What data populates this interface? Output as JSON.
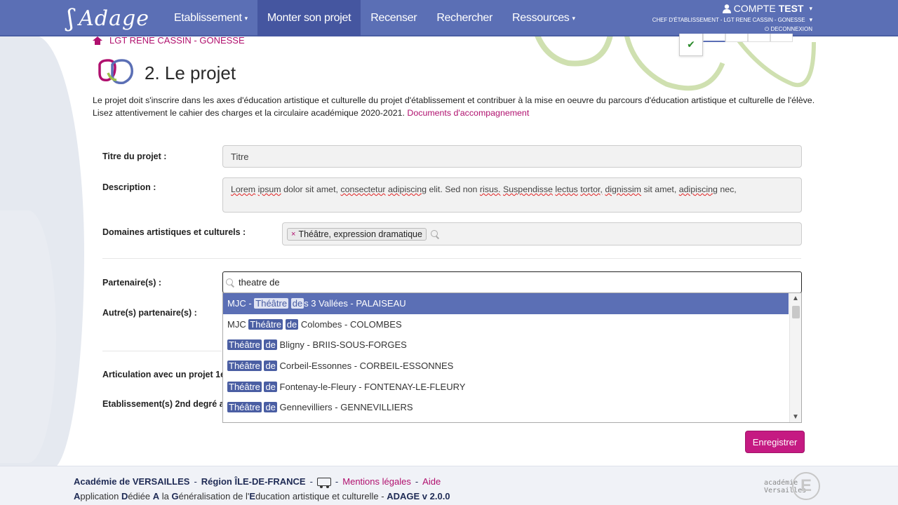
{
  "nav": {
    "logo": "Adage",
    "items": [
      {
        "label": "Etablissement",
        "caret": "▾"
      },
      {
        "label": "Monter son projet"
      },
      {
        "label": "Recenser"
      },
      {
        "label": "Rechercher"
      },
      {
        "label": "Ressources",
        "caret": "▾"
      }
    ],
    "account_label": "COMPTE",
    "account_name": "TEST",
    "account_role": "CHEF D'ÉTABLISSEMENT - LGT RENE CASSIN - GONESSE",
    "logout": "DECONNEXION"
  },
  "breadcrumb": "LGT RENE CASSIN - GONESSE",
  "title": "2. Le projet",
  "intro": {
    "text": "Le projet doit s'inscrire dans les axes d'éducation artistique et culturelle du projet d'établissement et contribuer à la mise en oeuvre du parcours d'éducation artistique et culturelle de l'élève. Lisez attentivement le cahier des charges et la circulaire académique 2020-2021.",
    "link": "Documents d'accompagnement"
  },
  "form": {
    "titre_label": "Titre du projet :",
    "titre_placeholder": "Titre",
    "description_label": "Description :",
    "description_words": [
      "Lorem",
      "ipsum",
      "dolor",
      "sit",
      "amet,",
      "consectetur",
      "adipiscing",
      "elit.",
      "Sed",
      "non",
      "risus.",
      "Suspendisse",
      "lectus",
      "tortor,",
      "dignissim",
      "sit",
      "amet,",
      "adipiscing",
      "nec,"
    ],
    "domaines_label": "Domaines artistiques et culturels :",
    "domaines_tag": "Théâtre, expression dramatique",
    "domaines_tag_remove": "×",
    "partenaires_label": "Partenaire(s) :",
    "autres_label": "Autre(s) partenaire(s) :",
    "articulation_label": "Articulation avec un projet 1e",
    "etablissements_label": "Etablissement(s) 2nd degré as",
    "search_value": "theatre de",
    "save_label": "Enregistrer"
  },
  "dropdown": {
    "options": [
      {
        "pre": "MJC - ",
        "hl1": "Théâtre",
        "mid": " ",
        "hl2": "de",
        "post": "s 3 Vallées - PALAISEAU",
        "selected": true
      },
      {
        "pre": "MJC ",
        "hl1": "Théâtre",
        "mid": " ",
        "hl2": "de",
        "post": " Colombes - COLOMBES",
        "selected": false
      },
      {
        "pre": "",
        "hl1": "Théâtre",
        "mid": " ",
        "hl2": "de",
        "post": " Bligny - BRIIS-SOUS-FORGES",
        "selected": false
      },
      {
        "pre": "",
        "hl1": "Théâtre",
        "mid": " ",
        "hl2": "de",
        "post": " Corbeil-Essonnes - CORBEIL-ESSONNES",
        "selected": false
      },
      {
        "pre": "",
        "hl1": "Théâtre",
        "mid": " ",
        "hl2": "de",
        "post": " Fontenay-le-Fleury - FONTENAY-LE-FLEURY",
        "selected": false
      },
      {
        "pre": "",
        "hl1": "Théâtre",
        "mid": " ",
        "hl2": "de",
        "post": " Gennevilliers - GENNEVILLIERS",
        "selected": false
      }
    ]
  },
  "footer": {
    "academie": "Académie de VERSAILLES",
    "region": "Région ÎLE-DE-FRANCE",
    "sep": "-",
    "mentions": "Mentions légales",
    "aide": "Aide",
    "line2_parts": [
      {
        "b": "A",
        "t": "pplication "
      },
      {
        "b": "D",
        "t": "édiée "
      },
      {
        "b": "A",
        "t": " la "
      },
      {
        "b": "G",
        "t": "énéralisation de l'"
      },
      {
        "b": "E",
        "t": "ducation artistique et culturelle - "
      }
    ],
    "version": "ADAGE v 2.0.0",
    "logo_line1": "académie",
    "logo_line2": "Versailles",
    "logo_letter": "E"
  },
  "colors": {
    "nav": "#5b6fb5",
    "accent": "#b0106e",
    "button": "#c51a82"
  }
}
